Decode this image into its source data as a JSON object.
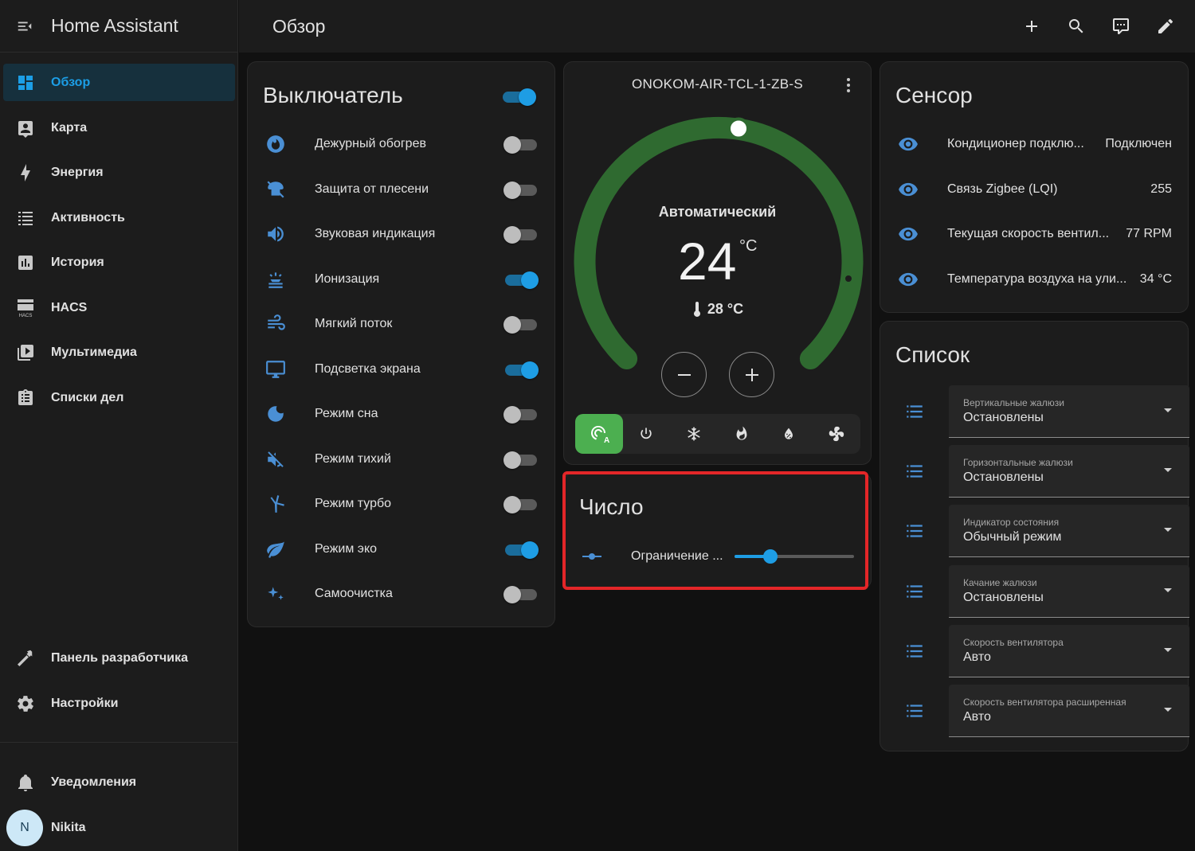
{
  "app": {
    "title": "Home Assistant"
  },
  "sidebar": {
    "items": [
      {
        "label": "Обзор",
        "icon": "dashboard-icon",
        "active": true
      },
      {
        "label": "Карта",
        "icon": "map-icon"
      },
      {
        "label": "Энергия",
        "icon": "lightning-bolt-icon"
      },
      {
        "label": "Активность",
        "icon": "list-icon"
      },
      {
        "label": "История",
        "icon": "chart-box-icon"
      },
      {
        "label": "HACS",
        "icon": "hacs-icon"
      },
      {
        "label": "Мультимедиа",
        "icon": "play-box-icon"
      },
      {
        "label": "Списки дел",
        "icon": "clipboard-list-icon"
      }
    ],
    "developer_tools": "Панель разработчика",
    "settings": "Настройки",
    "notifications": "Уведомления",
    "user": {
      "name": "Nikita",
      "initial": "N"
    },
    "hacs_badge": "HACS"
  },
  "header": {
    "title": "Обзор"
  },
  "switch_card": {
    "title": "Выключатель",
    "header_toggle_on": true,
    "items": [
      {
        "label": "Дежурный обогрев",
        "icon": "fire-circle-icon",
        "on": false
      },
      {
        "label": "Защита от плесени",
        "icon": "mold-icon",
        "on": false
      },
      {
        "label": "Звуковая индикация",
        "icon": "volume-icon",
        "on": false
      },
      {
        "label": "Ионизация",
        "icon": "ionization-icon",
        "on": true
      },
      {
        "label": "Мягкий поток",
        "icon": "wind-icon",
        "on": false
      },
      {
        "label": "Подсветка экрана",
        "icon": "monitor-icon",
        "on": true
      },
      {
        "label": "Режим сна",
        "icon": "moon-icon",
        "on": false
      },
      {
        "label": "Режим тихий",
        "icon": "volume-off-icon",
        "on": false
      },
      {
        "label": "Режим турбо",
        "icon": "turbine-icon",
        "on": false
      },
      {
        "label": "Режим эко",
        "icon": "leaf-icon",
        "on": true
      },
      {
        "label": "Самоочистка",
        "icon": "sparkle-icon",
        "on": false
      }
    ]
  },
  "thermostat": {
    "name": "ONOKOM-AIR-TCL-1-ZB-S",
    "mode": "Автоматический",
    "target": "24",
    "unit": "°C",
    "current": "28 °C",
    "modes": [
      "auto-mode-icon",
      "power-icon",
      "snowflake-icon",
      "fire-icon",
      "water-percent-icon",
      "fan-icon"
    ],
    "colors": {
      "arc": "#2f6a30",
      "mode_active": "#4caf50"
    }
  },
  "number_card": {
    "title": "Число",
    "label": "Ограничение ...",
    "value_fraction": 0.3
  },
  "sensor_card": {
    "title": "Сенсор",
    "items": [
      {
        "label": "Кондиционер подклю...",
        "value": "Подключен"
      },
      {
        "label": "Связь Zigbee (LQI)",
        "value": "255"
      },
      {
        "label": "Текущая скорость вентил...",
        "value": "77 RPM"
      },
      {
        "label": "Температура воздуха на ули...",
        "value": "34 °C"
      }
    ]
  },
  "list_card": {
    "title": "Список",
    "items": [
      {
        "label": "Вертикальные жалюзи",
        "value": "Остановлены"
      },
      {
        "label": "Горизонтальные жалюзи",
        "value": "Остановлены"
      },
      {
        "label": "Индикатор состояния",
        "value": "Обычный режим"
      },
      {
        "label": "Качание жалюзи",
        "value": "Остановлены"
      },
      {
        "label": "Скорость вентилятора",
        "value": "Авто"
      },
      {
        "label": "Скорость вентилятора расширенная",
        "value": "Авто"
      }
    ]
  },
  "colors": {
    "accent": "#1e9de4",
    "icon_blue": "#4a8fd4",
    "highlight": "#e32628"
  }
}
